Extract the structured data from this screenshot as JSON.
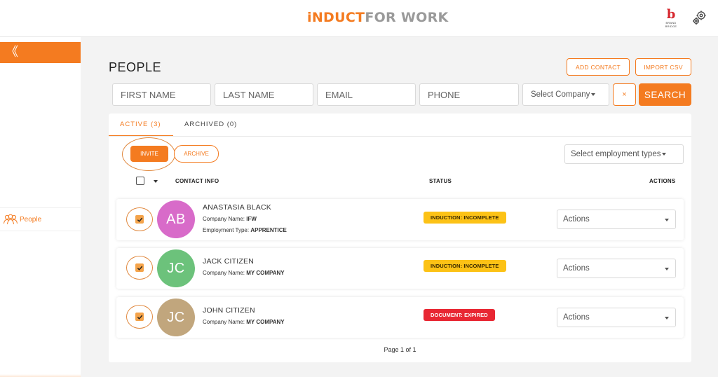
{
  "header": {
    "logo_part1": "iNDUCT",
    "logo_part2": "FOR WORK",
    "brand_mark": "b",
    "brand_text": "BRAND BRIDGE"
  },
  "sidebar": {
    "collapse_glyph": "《",
    "items": [
      {
        "label": "People",
        "icon": "people-icon"
      }
    ]
  },
  "page": {
    "title": "PEOPLE",
    "add_contact_label": "ADD CONTACT",
    "import_csv_label": "IMPORT CSV"
  },
  "filters": {
    "first_name_placeholder": "FIRST NAME",
    "last_name_placeholder": "LAST NAME",
    "email_placeholder": "EMAIL",
    "phone_placeholder": "PHONE",
    "company_select": "Select Company",
    "clear_label": "×",
    "search_label": "SEARCH"
  },
  "tabs": [
    {
      "label": "ACTIVE (3)",
      "active": true
    },
    {
      "label": "ARCHIVED (0)",
      "active": false
    }
  ],
  "toolbar": {
    "invite_label": "INVITE",
    "archive_label": "ARCHIVE",
    "employment_select": "Select employment types"
  },
  "table": {
    "columns": [
      "CONTACT INFO",
      "STATUS",
      "ACTIONS"
    ],
    "rows": [
      {
        "initials": "AB",
        "avatar_color": "#d86bc9",
        "name": "ANASTASIA BLACK",
        "company_label": "Company Name: ",
        "company": "IFW",
        "employment_label": "Employment Type: ",
        "employment": "APPRENTICE",
        "status": "INDUCTION: INCOMPLETE",
        "status_color": "#fcc216",
        "actions": "Actions",
        "checked": true
      },
      {
        "initials": "JC",
        "avatar_color": "#6cc27b",
        "name": "JACK CITIZEN",
        "company_label": "Company Name: ",
        "company": "MY COMPANY",
        "status": "INDUCTION: INCOMPLETE",
        "status_color": "#fcc216",
        "actions": "Actions",
        "checked": true
      },
      {
        "initials": "JC",
        "avatar_color": "#c1a67d",
        "name": "JOHN CITIZEN",
        "company_label": "Company Name: ",
        "company": "MY COMPANY",
        "status": "DOCUMENT: EXPIRED",
        "status_color": "#e82733",
        "actions": "Actions",
        "checked": true
      }
    ]
  },
  "pagination": {
    "text": "Page 1 of 1"
  },
  "colors": {
    "accent": "#f47b20",
    "warning": "#fcc216",
    "danger": "#e82733"
  }
}
